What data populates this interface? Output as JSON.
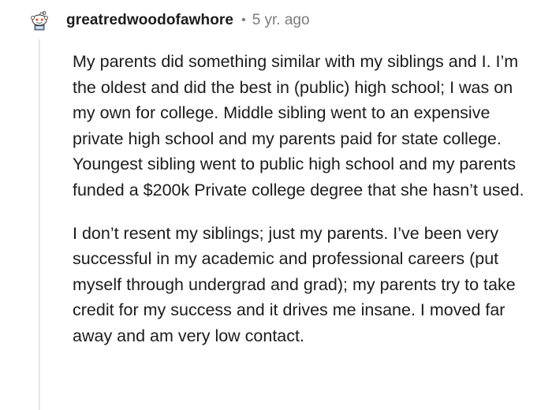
{
  "comment": {
    "avatar_icon": "snoo-avatar-icon",
    "username": "greatredwoodofawhore",
    "separator": "•",
    "timestamp": "5 yr. ago",
    "paragraphs": [
      "My parents did something similar with my siblings and I. I’m the oldest and did the best in (public) high school; I was on my own for college. Middle sibling went to an expensive private high school and my parents paid for state college. Youngest sibling went to public high school and my parents funded a $200k Private college degree that she hasn’t used.",
      "I don’t resent my siblings; just my parents. I’ve been very successful in my academic and professional careers (put myself through undergrad and grad); my parents try to take credit for my success and it drives me insane. I moved far away and am very low contact."
    ]
  }
}
